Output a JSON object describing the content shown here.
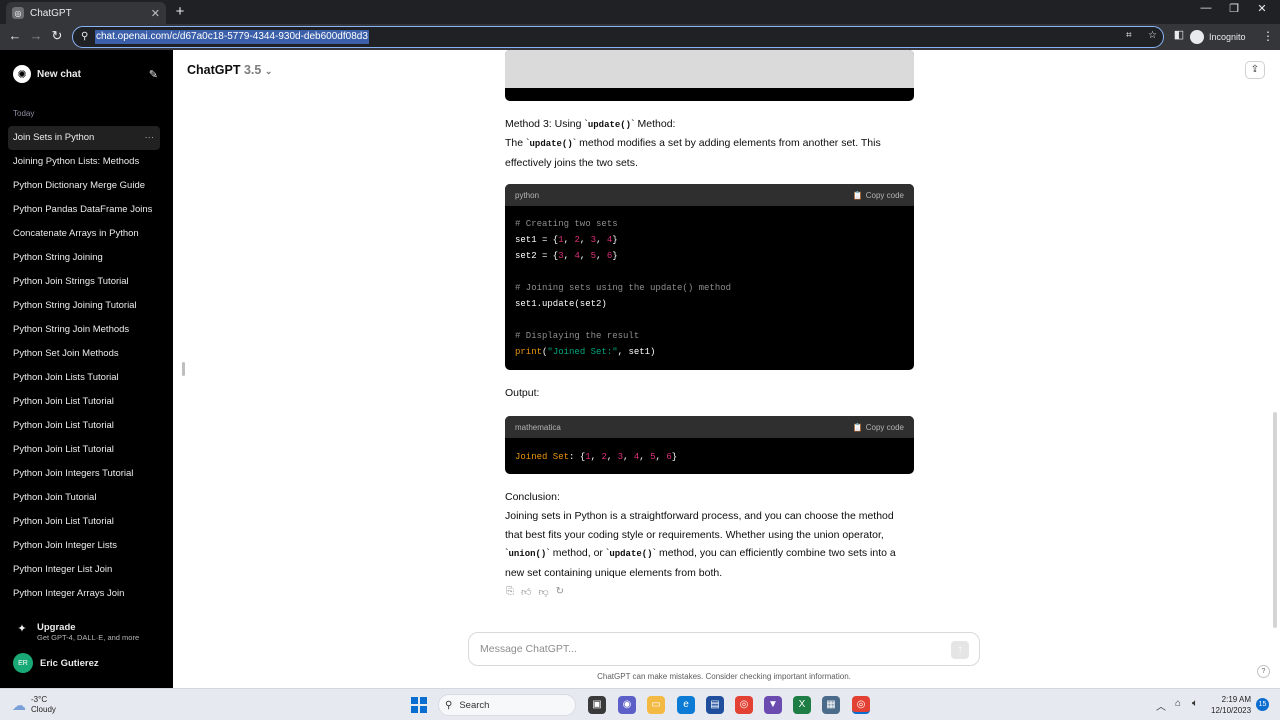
{
  "browser": {
    "tab_title": "ChatGPT",
    "url": "chat.openai.com/c/d67a0c18-5779-4344-930d-deb600df08d3",
    "profile": "Incognito"
  },
  "sidebar": {
    "new_chat": "New chat",
    "section_today": "Today",
    "items": [
      {
        "label": "Join Sets in Python"
      },
      {
        "label": "Joining Python Lists: Methods"
      },
      {
        "label": "Python Dictionary Merge Guide"
      },
      {
        "label": "Python Pandas DataFrame Joins"
      },
      {
        "label": "Concatenate Arrays in Python"
      },
      {
        "label": "Python String Joining"
      },
      {
        "label": "Python Join Strings Tutorial"
      },
      {
        "label": "Python String Joining Tutorial"
      },
      {
        "label": "Python String Join Methods"
      },
      {
        "label": "Python Set Join Methods"
      },
      {
        "label": "Python Join Lists Tutorial"
      },
      {
        "label": "Python Join List Tutorial"
      },
      {
        "label": "Python Join List Tutorial"
      },
      {
        "label": "Python Join List Tutorial"
      },
      {
        "label": "Python Join Integers Tutorial"
      },
      {
        "label": "Python Join Tutorial"
      },
      {
        "label": "Python Join List Tutorial"
      },
      {
        "label": "Python Join Integer Lists"
      },
      {
        "label": "Python Integer List Join"
      },
      {
        "label": "Python Integer Arrays Join"
      }
    ],
    "upgrade_title": "Upgrade",
    "upgrade_sub": "Get GPT-4, DALL·E, and more",
    "user_initials": "ER",
    "user_name": "Eric Gutierez"
  },
  "header": {
    "model": "ChatGPT",
    "version": "3.5"
  },
  "content": {
    "method3_prefix": "Method 3: Using `",
    "method3_code": "update()",
    "method3_suffix": "` Method:",
    "para_prefix": "The `",
    "para_code": "update()",
    "para_line1": "` method modifies a set by adding elements from another set. This",
    "para_line2": "effectively joins the two sets.",
    "code1_lang": "python",
    "copy_label": "Copy code",
    "output_label": "Output:",
    "code2_lang": "mathematica",
    "conclusion_label": "Conclusion:",
    "conc_line1": "Joining sets in Python is a straightforward process, and you can choose the method",
    "conc_line2": "that best fits your coding style or requirements. Whether using the union operator,",
    "conc_code1": "union()",
    "conc_mid1": "` method, or `",
    "conc_code2": "update()",
    "conc_mid2": "` method, you can efficiently combine two sets into a",
    "conc_line4": "new set containing unique elements from both."
  },
  "composer": {
    "placeholder": "Message ChatGPT...",
    "disclaimer": "ChatGPT can make mistakes. Consider checking important information."
  },
  "taskbar": {
    "temp": "-3°C",
    "weather": "Cloudy",
    "search": "Search",
    "time": "2:19 AM",
    "date": "12/10/2023",
    "notifications": "15"
  }
}
